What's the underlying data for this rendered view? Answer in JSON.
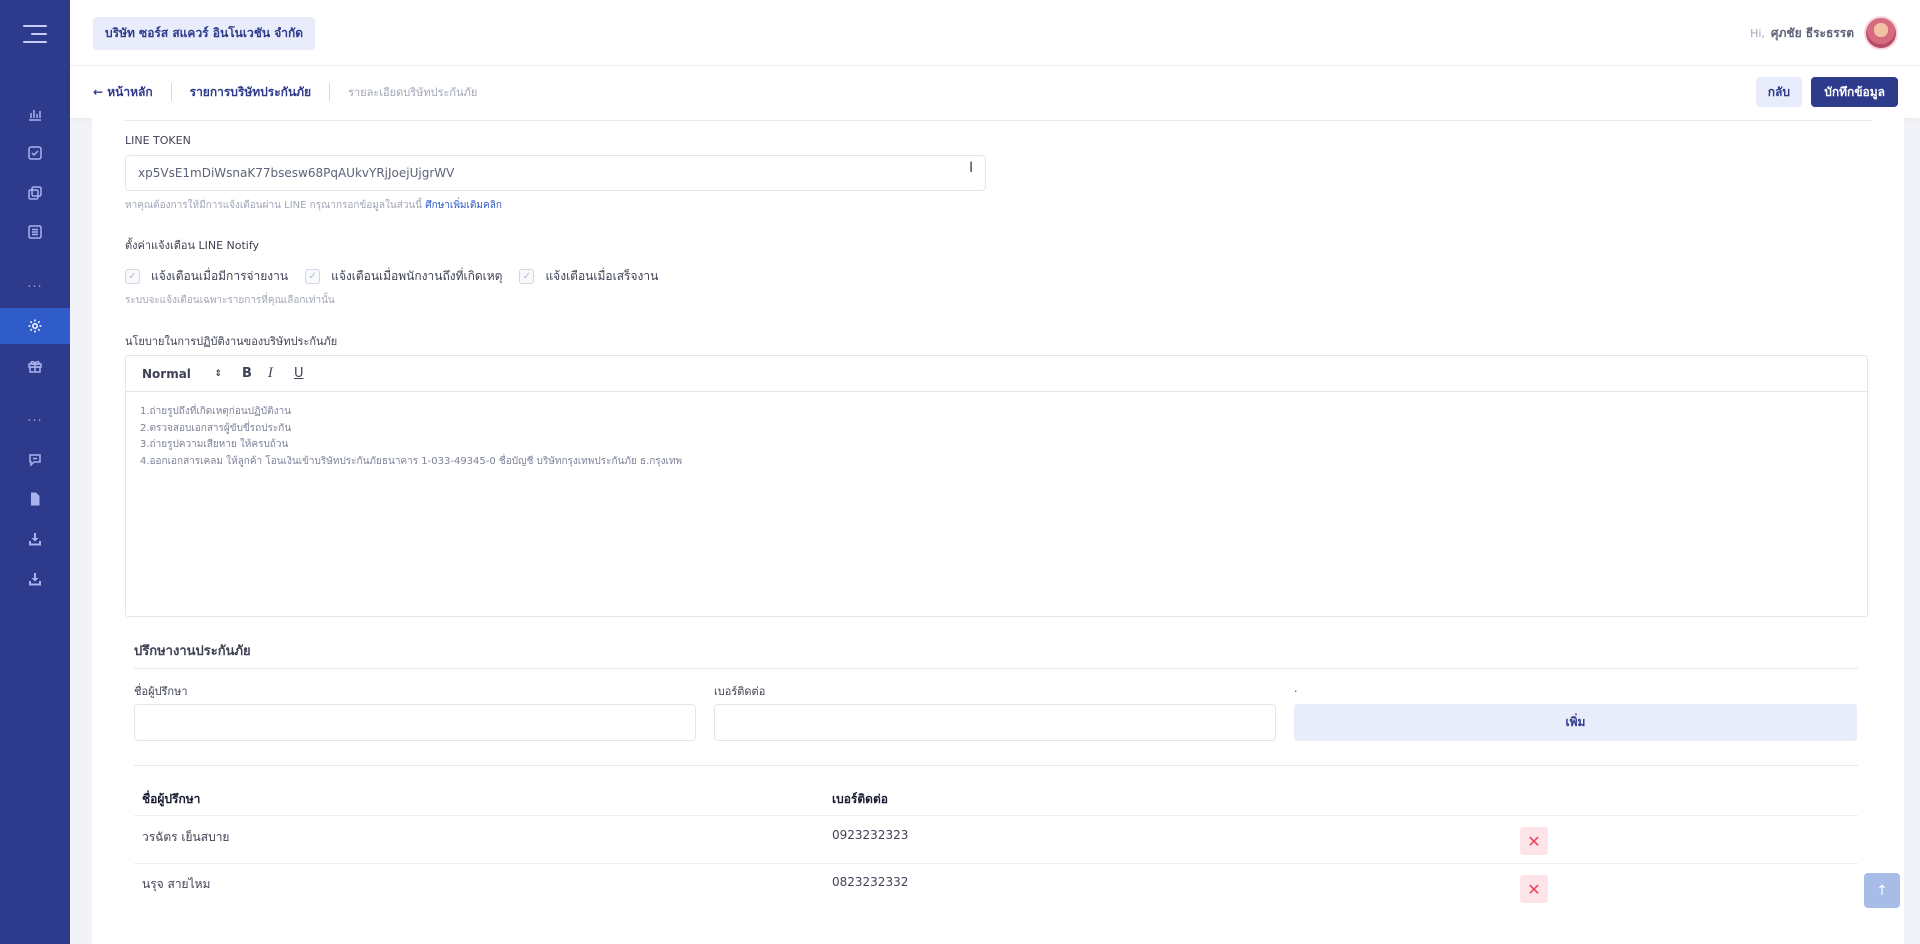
{
  "header": {
    "company": "บริษัท ซอร์ส สแควร์ อินโนเวชัน จำกัด",
    "hi": "Hi,",
    "user_name": "ศุภชัย ธีระธรรต"
  },
  "breadcrumb": {
    "home": "← หน้าหลัก",
    "list": "รายการบริษัทประกันภัย",
    "current": "รายละเอียดบริษัทประกันภัย"
  },
  "actions": {
    "back": "กลับ",
    "save": "บักทึกข้อมูล"
  },
  "sidebar": {
    "icons": [
      "menu-icon",
      "chart-icon",
      "check-square-icon",
      "copy-icon",
      "list-icon",
      "settings-icon",
      "gift-icon",
      "chat-icon",
      "file-icon",
      "download-icon",
      "download-icon"
    ],
    "dots": "..."
  },
  "line_token": {
    "label": "LINE TOKEN",
    "value": "xp5VsE1mDiWsnaK77bsesw68PqAUkvYRjJoejUjgrWV",
    "hint": "หาคุณต้องการให้มีการแจ้งเตือนผ่าน LINE กรุณากรอกข้อมูลในส่วนนี้",
    "hint_link": "ศึกษาเพิ่มเติมคลิก"
  },
  "notify": {
    "label": "ตั้งค่าแจ้งเตือน LINE Notify",
    "options": [
      {
        "label": "แจ้งเตือนเมื่อมีการจ่ายงาน",
        "checked": true
      },
      {
        "label": "แจ้งเตือนเมื่อพนักงานถึงที่เกิดเหตุ",
        "checked": true
      },
      {
        "label": "แจ้งเตือนเมื่อเสร็จงาน",
        "checked": true
      }
    ],
    "hint": "ระบบจะแจ้งเตือนเฉพาะรายการที่คุณเลือกเท่านั้น"
  },
  "policy": {
    "label": "นโยบายในการปฏิบัติงานของบริษัทประกันภัย",
    "format": "Normal",
    "bold": "B",
    "italic": "I",
    "underline": "U",
    "lines": [
      "1.ถ่ายรูปถึงที่เกิดเหตุก่อนปฏิบัติงาน",
      "2.ตรวจสอบเอกสารผู้ขับขี่รถประกัน",
      "3.ถ่ายรูปความเสียหาย ให้ครบถ้วน",
      "4.ออกเอกสารเคลม ให้ลูกค้า โอนเงินเข้าบริษัทประกันภัยธนาคาร 1-033-49345-0 ชื่อบัญชี บริษัทกรุงเทพประกันภัย ธ.กรุงเทพ"
    ]
  },
  "consultants": {
    "title": "ปรึกษางานประกันภัย",
    "name_label": "ชื่อผู้ปรึกษา",
    "phone_label": "เบอร์ติดต่อ",
    "add_label": ".",
    "add_button": "เพิ่ม",
    "columns": [
      "ชื่อผู้ปรึกษา",
      "เบอร์ติดต่อ"
    ],
    "rows": [
      {
        "name": "วรฉัตร เย็นสบาย",
        "phone": "0923232323"
      },
      {
        "name": "นรุจ สายไหม",
        "phone": "0823232332"
      }
    ]
  }
}
